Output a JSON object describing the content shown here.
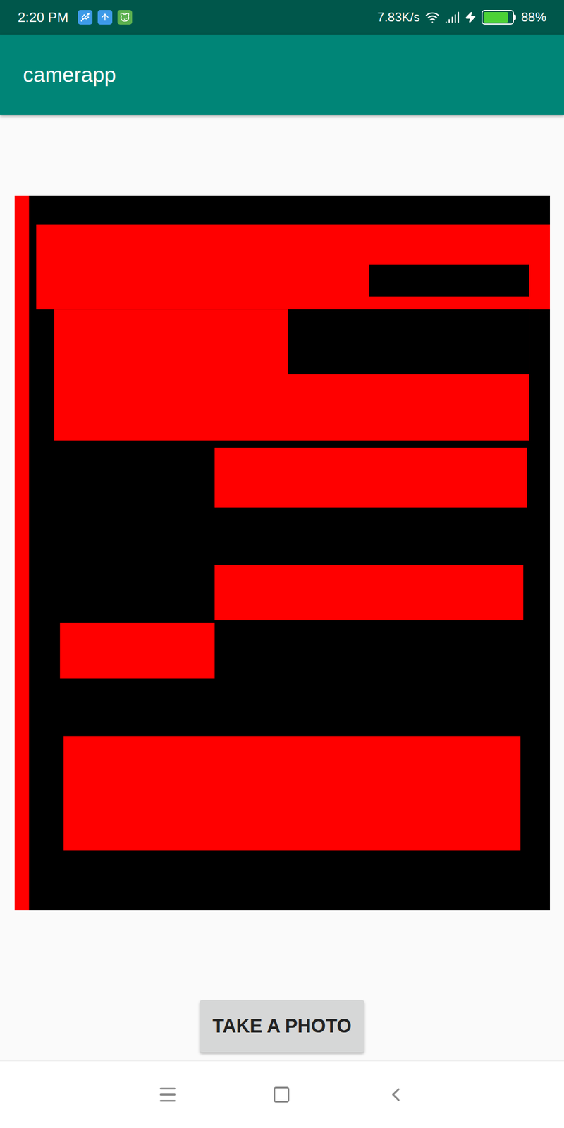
{
  "status_bar": {
    "time": "2:20 PM",
    "speed": "7.83K/s",
    "battery": {
      "level": 0.88,
      "reading": "88%",
      "charging": true
    }
  },
  "app_bar": {
    "title": "camerapp"
  },
  "button": {
    "label": "TAKE A PHOTO"
  }
}
